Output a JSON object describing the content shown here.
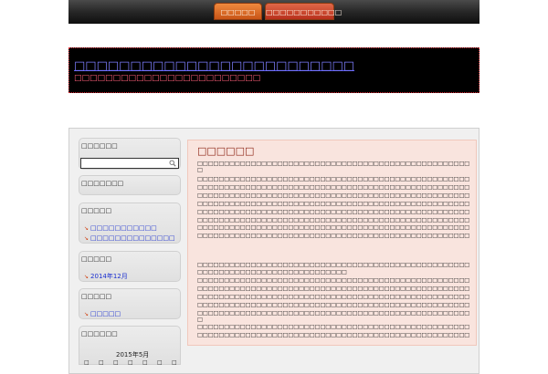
{
  "nav": {
    "home_label": "□□□□□",
    "about_label": "□□□□□□□□□□□"
  },
  "header": {
    "title": "□□□□□□□□□□□□□□□□□□□□□□□□□",
    "description": "□□□□□□□□□□□□□□□□□□□□□□□□"
  },
  "sidebar": {
    "search_title": "□□□□□□",
    "recent_title": "□□□□□□□",
    "recent_posts_title": "□□□□□",
    "recent_posts": [
      "□□□□□□□□□□□",
      "□□□□□□□□□□□□□□"
    ],
    "archives_title": "□□□□□",
    "archives": [
      "2014年12月"
    ],
    "categories_title": "□□□□□",
    "categories": [
      "□□□□□"
    ],
    "calendar_title": "□□□□□□",
    "calendar_month": "2015年5月",
    "calendar_days": [
      "□",
      "□",
      "□",
      "□",
      "□",
      "□",
      "□"
    ]
  },
  "post": {
    "title": "□□□□□□",
    "paragraph1": [
      "□□□□□□□□□□□□□□□□□□□□□□□□□□□□□□□□□□□□□□□□□□□□□□□□□□□□□□□□□□□□□□□□□□□□□□□□□□□□□□",
      "□",
      "□□□□□□□□□□□□□□□□□□□□□□□□□□□□□□□□□□□□□□□□□□□□□□□□□□□□□□□□□□□□□□□□□□□",
      "□□□□□□□□□□□□□□□□□□□□□□□□□□□□□□□□□□□□□□□□□□□□□□□□□□□□□□□□□□□□□□□□□□□□□□□",
      "□□□□□□□□□□□□□□□□□□□□□□□□□□□□□□□□□□□□□□□□□□□□□□□□□□□□□□□□□□□□□□□□□□□□□□□□□□",
      "□□□□□□□□□□□□□□□□□□□□□□□□□□□□□□□□□□□□□□□□□□□□□□□□□□□□□",
      "□□□□□□□□□□□□□□□□□□□□□□□□□□□□□□□□□□□□□□□□□□□□□□□□□□□□□□□□□□□□□□□□□□□",
      "□□□□□□□□□□□□□□□□□□□□□□□□□□□□□□□□□□□□□□□□□□□□□□□□□□□□□□□□",
      "□□□□□□□□□□□□□□□□□□□□□□□□□□□□□□□□□□□□□□□□□□□□□□□□□□□□□□□□□□□□□",
      "□□□□□□□□□□□□□□□□□□□□□□□□□□□□□□□□□□□□□□□□□□□□□□□□□□□□□□□□□□□□□□□□□□□"
    ],
    "paragraph2": [
      "□□□□□□□□□□□□□□□□□□□□□□□□□□□□□□□□□□□□□□□□□□□□□□□□□□□□□□□□□□□□□□□□□□□□□□□□□□□□□□",
      "□□□□□□□□□□□□□□□□□□□□□□□□□□□□",
      "□□□□□□□□□□□□□□□□□□□□□□□□□□□□□□□□□□□□□□□□□□□□□□□□□□□□□□□□□□",
      "□□□□□□□□□□□□□□□□□□□□□□□□□□□□□□□□□□□□□□□□□□□□□□□□□□□□□□□□□□□□□□□□□□□□□□□□□□□□□□",
      "□□□□□□□□□□□□□□□□□□□□□□□□□□□□□□□□□□□□□□□□□□□□□□□□□□□□□□□□□□□□□□□□□□□□□□□□□□□□□□",
      "□□□□□□□□□□□□□□□□□□□□□□□□□□□□□□□□□□□□□□□□□□□□□□□□□□□□□□□□□□□□□□□□□□□□□□□□□□□□□□",
      "□□□□□□□□□□□□□□□□□□□□□□□□□□□□□□□□□□□□□□□□□□□□□□□□□□□□□□□□□□□□□□□□□□□□□□□□□□□□□□",
      "□",
      "□□□□□□□□□□□□□□□□□□□□□□□□□□□□□□□□□□□□□□□□□□□□□□□□□□□□□□□□□□□□□□□□□□□□□□□□□□□□□□",
      "□□□□□□□□□□□□□□□□□□□□□□□□□□□□□□□□□□□□□□□□□□□□□□□□□□□□□□□□□□□□□□□□□□□□□□□"
    ]
  },
  "colors": {
    "accent_orange": "#e06a2a",
    "header_title": "#7e7eff",
    "header_desc": "#ff5f7a",
    "link": "#1a2fd0",
    "post_bg": "#f9e4de"
  }
}
